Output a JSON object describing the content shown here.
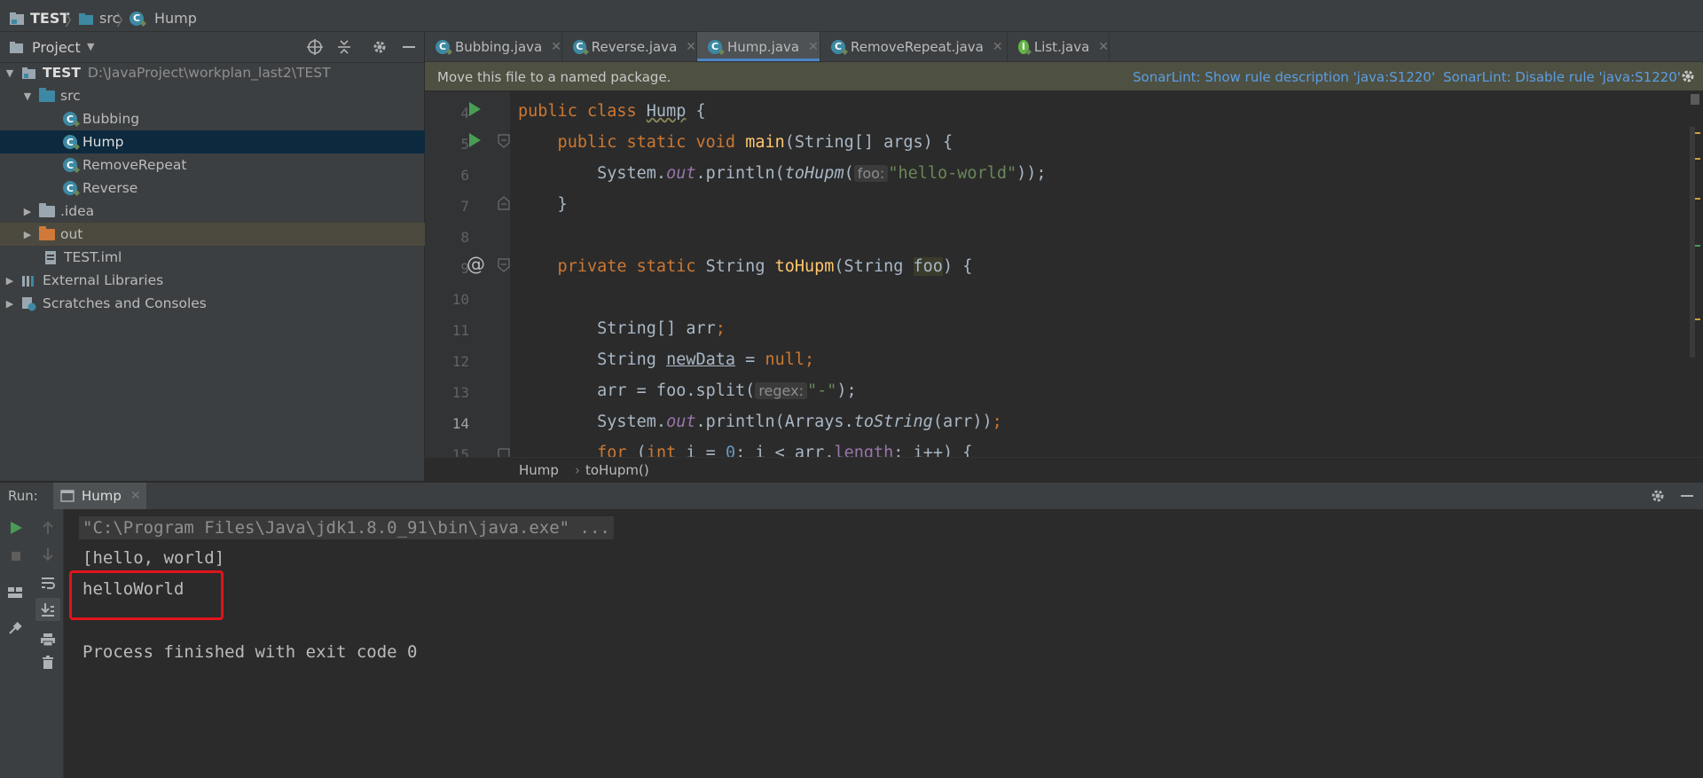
{
  "breadcrumb": {
    "project": "TEST",
    "folder": "src",
    "file": "Hump"
  },
  "project_panel": {
    "title": "Project",
    "tree": [
      {
        "label": "TEST",
        "path": "D:\\JavaProject\\workplan_last2\\TEST"
      },
      {
        "label": "src"
      },
      {
        "label": "Bubbing"
      },
      {
        "label": "Hump"
      },
      {
        "label": "RemoveRepeat"
      },
      {
        "label": "Reverse"
      },
      {
        "label": ".idea"
      },
      {
        "label": "out"
      },
      {
        "label": "TEST.iml"
      },
      {
        "label": "External Libraries"
      },
      {
        "label": "Scratches and Consoles"
      }
    ]
  },
  "tabs": [
    {
      "label": "Bubbing.java"
    },
    {
      "label": "Reverse.java"
    },
    {
      "label": "Hump.java",
      "active": true
    },
    {
      "label": "RemoveRepeat.java"
    },
    {
      "label": "List.java"
    }
  ],
  "banner": {
    "message": "Move this file to a named package.",
    "link1": "SonarLint: Show rule description 'java:S1220'",
    "link2": "SonarLint: Disable rule 'java:S1220'"
  },
  "editor": {
    "line_numbers": [
      "4",
      "5",
      "6",
      "7",
      "8",
      "9",
      "10",
      "11",
      "12",
      "13",
      "14",
      "15"
    ],
    "current_line": "14",
    "code": {
      "l4_a": "public class ",
      "l4_b": "Hump",
      "l4_c": " {",
      "l5_a": "    public static void ",
      "l5_b": "main",
      "l5_c": "(String[] args) {",
      "l6_a": "        System.",
      "l6_b": "out",
      "l6_c": ".println(",
      "l6_d": "toHupm",
      "l6_e": "(",
      "l6_hint": "foo:",
      "l6_f": "\"hello-world\"",
      "l6_g": "));",
      "l7": "    }",
      "l9_a": "    private static ",
      "l9_b": "String ",
      "l9_c": "toHupm",
      "l9_d": "(String ",
      "l9_e": "foo",
      "l9_f": ") {",
      "l11_a": "        String[] arr",
      "l11_b": ";",
      "l12_a": "        String ",
      "l12_b": "newData",
      "l12_c": " = ",
      "l12_d": "null;",
      "l13_a": "        arr = foo.split(",
      "l13_hint": "regex:",
      "l13_b": "\"-\"",
      "l13_c": ");",
      "l14_a": "        System.",
      "l14_b": "out",
      "l14_c": ".println(Arrays.",
      "l14_d": "toString",
      "l14_e": "(arr))",
      "l14_f": ";",
      "l15_a": "        for",
      "l15_b": " (",
      "l15_c": "int",
      "l15_d": " i = ",
      "l15_e": "0",
      "l15_f": "; i < arr.",
      "l15_g": "length",
      "l15_h": "; i++) {"
    },
    "breadcrumb": {
      "class": "Hump",
      "method": "toHupm()"
    }
  },
  "run": {
    "label": "Run:",
    "tab": "Hump",
    "output": [
      "\"C:\\Program Files\\Java\\jdk1.8.0_91\\bin\\java.exe\" ...",
      "[hello, world]",
      "helloWorld",
      "Process finished with exit code 0"
    ]
  },
  "colors": {
    "accent": "#4a88c7",
    "run_green": "#499c54",
    "highlight_box": "#e0141b",
    "link": "#5b9ee3"
  }
}
